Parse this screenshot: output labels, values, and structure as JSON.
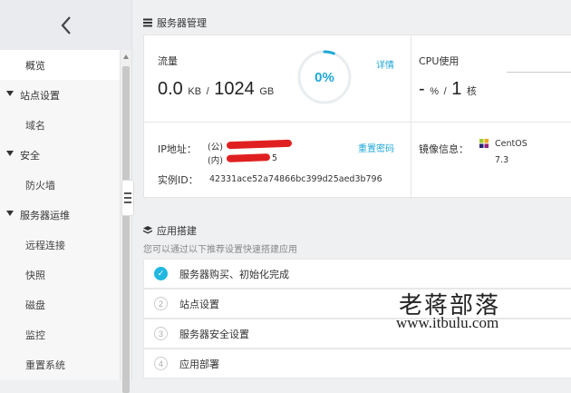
{
  "sidebar": {
    "items": [
      {
        "label": "概览",
        "type": "sub",
        "active": true
      },
      {
        "label": "站点设置",
        "type": "top"
      },
      {
        "label": "域名",
        "type": "sub"
      },
      {
        "label": "安全",
        "type": "top"
      },
      {
        "label": "防火墙",
        "type": "sub"
      },
      {
        "label": "服务器运维",
        "type": "top"
      },
      {
        "label": "远程连接",
        "type": "sub"
      },
      {
        "label": "快照",
        "type": "sub"
      },
      {
        "label": "磁盘",
        "type": "sub"
      },
      {
        "label": "监控",
        "type": "sub"
      },
      {
        "label": "重置系统",
        "type": "sub"
      }
    ]
  },
  "server": {
    "title": "服务器管理",
    "traffic_label": "流量",
    "traffic_used": "0.0",
    "traffic_used_unit": "KB",
    "traffic_sep": "/",
    "traffic_total": "1024",
    "traffic_total_unit": "GB",
    "traffic_percent": "0%",
    "traffic_fraction": 0,
    "details_link": "详情",
    "cpu_label": "CPU使用",
    "cpu_used": "-",
    "cpu_used_unit": "%",
    "cpu_sep": "/",
    "cpu_total": "1",
    "cpu_total_unit": "核",
    "ip_label": "IP地址：",
    "ip_public_tag": "(公)",
    "ip_private_tag": "(内)",
    "ip_private_suffix": "5",
    "reset_password_link": "重置密码",
    "image_label": "镜像信息：",
    "os_name": "CentOS",
    "os_version": "7.3",
    "instance_label": "实例ID：",
    "instance_id": "42331ace52a74866bc399d25aed3b796"
  },
  "apps": {
    "title": "应用搭建",
    "hint": "您可以通过以下推荐设置快速搭建应用",
    "steps": [
      {
        "num": "✓",
        "label": "服务器购买、初始化完成",
        "done": true
      },
      {
        "num": "2",
        "label": "站点设置",
        "done": false
      },
      {
        "num": "3",
        "label": "服务器安全设置",
        "done": false
      },
      {
        "num": "4",
        "label": "应用部署",
        "done": false
      }
    ]
  },
  "watermark": {
    "cn": "老蒋部落",
    "en": "www.itbulu.com"
  },
  "colors": {
    "accent": "#20a8d8",
    "redaction": "#e02020"
  }
}
